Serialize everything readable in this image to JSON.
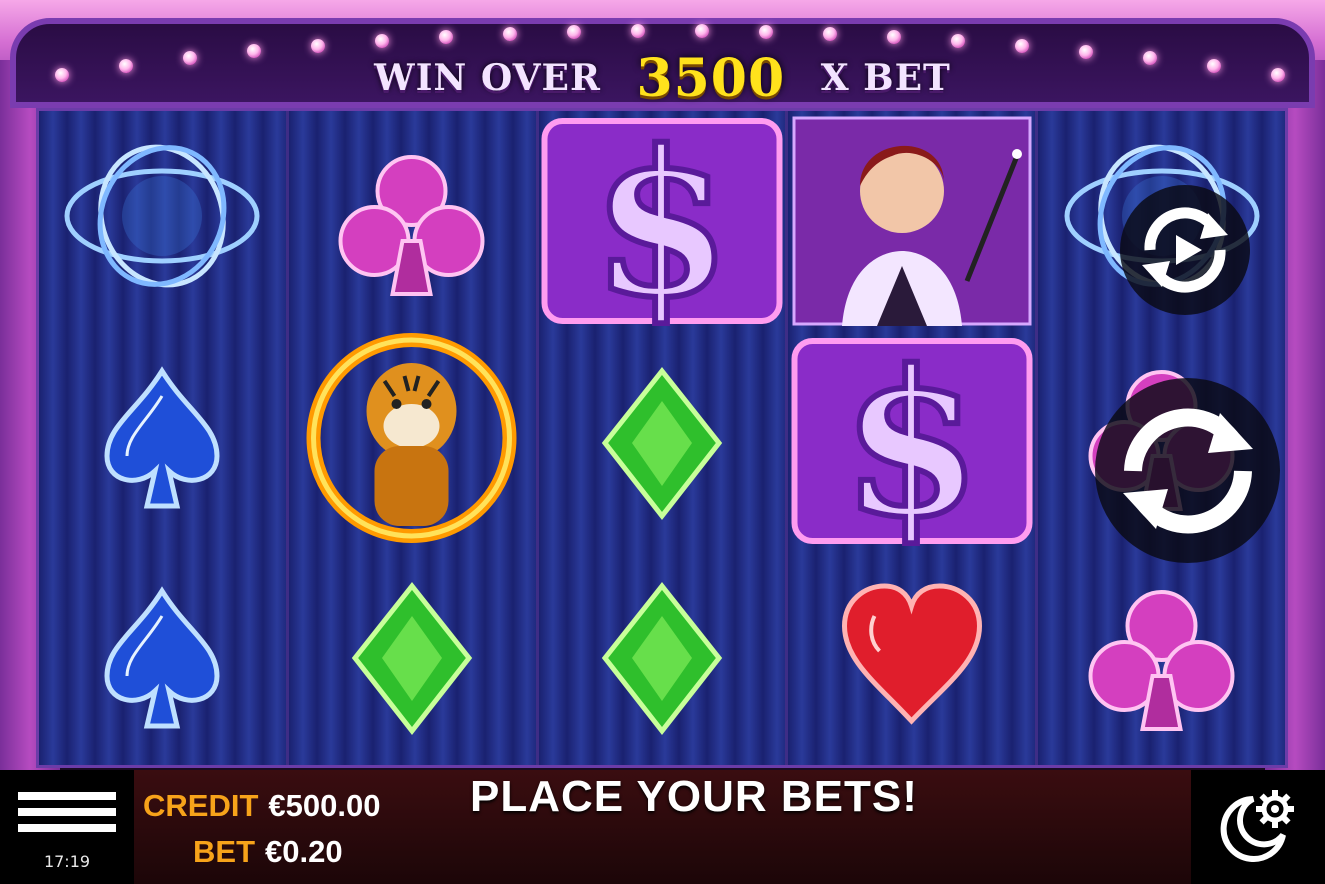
{
  "header": {
    "prefix": "WIN OVER",
    "multiplier": "3500",
    "suffix": "X BET"
  },
  "reels": [
    [
      "rings-icon",
      "blue-spade-icon",
      "blue-spade-icon"
    ],
    [
      "pink-club-icon",
      "tiger-fire-ring-icon",
      "green-diamond-icon"
    ],
    [
      "dollar-sign-icon",
      "green-diamond-icon",
      "green-diamond-icon"
    ],
    [
      "magician-woman-icon",
      "dollar-sign-icon",
      "red-heart-icon"
    ],
    [
      "rings-icon",
      "pink-club-icon",
      "pink-club-icon"
    ]
  ],
  "bottom": {
    "credit_label": "CREDIT",
    "credit_value": "€500.00",
    "bet_label": "BET",
    "bet_value": "€0.20",
    "message": "PLACE YOUR BETS!",
    "clock": "17:19"
  },
  "buttons": {
    "autoplay_icon": "autoplay-icon",
    "spin_icon": "spin-icon",
    "menu_icon": "hamburger-menu-icon",
    "settings_icon": "settings-gear-icon"
  },
  "colors": {
    "accent_gold": "#ffe21c",
    "label_orange": "#f7a31a",
    "frame_purple": "#6b3ca8"
  }
}
